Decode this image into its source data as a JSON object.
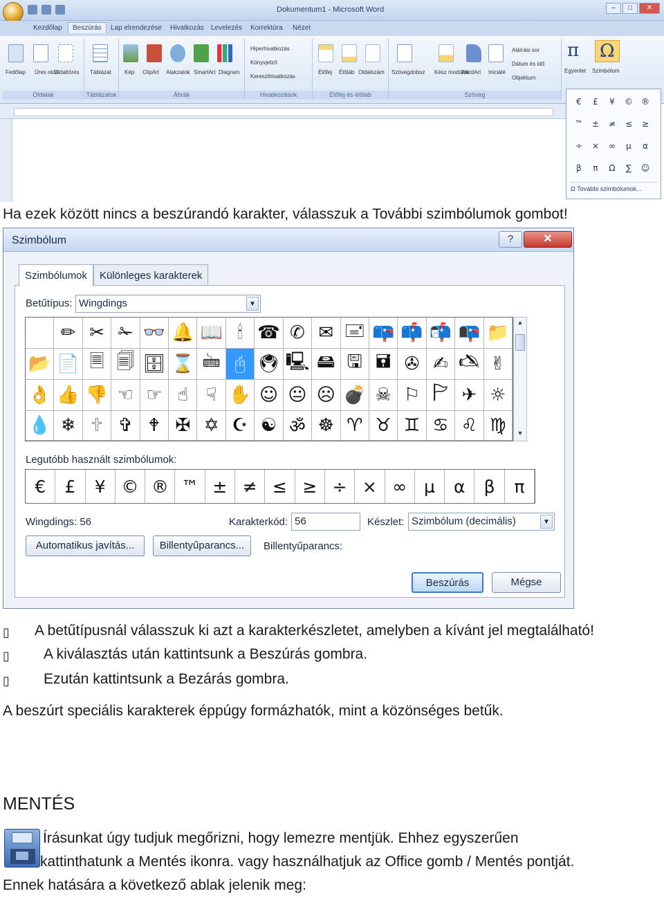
{
  "word_window": {
    "title": "Dokumentum1 - Microsoft Word",
    "ribbon_tabs": [
      "Kezdőlap",
      "Beszúrás",
      "Lap elrendezése",
      "Hivatkozás",
      "Levelezés",
      "Korrektúra",
      "Nézet"
    ],
    "active_tab": "Beszúrás",
    "groups": [
      {
        "label": "Oldalak",
        "buttons": [
          "Fedőlap",
          "Üres oldal",
          "Oldaltörés"
        ]
      },
      {
        "label": "Táblázatok",
        "buttons": [
          "Táblázat"
        ]
      },
      {
        "label": "Ábrák",
        "buttons": [
          "Kép",
          "ClipArt",
          "Alakzatok",
          "SmartArt",
          "Diagram"
        ]
      },
      {
        "label": "Hivatkozások",
        "buttons": [
          "Hiperhivatkozás",
          "Könyvjelző",
          "Kereszthivatkozás"
        ]
      },
      {
        "label": "Élőfej és élőláb",
        "buttons": [
          "Élőfej",
          "Élőláb",
          "Oldalszám"
        ]
      },
      {
        "label": "Szöveg",
        "buttons": [
          "Szövegdoboz",
          "Kész modulok",
          "WordArt",
          "Iniciálé",
          "Aláírási sor",
          "Dátum és idő",
          "Objektum"
        ]
      }
    ],
    "equation_label": "Egyenlet",
    "symbol_label": "Szimbólum",
    "symbol_dropdown": [
      "€",
      "£",
      "¥",
      "©",
      "®",
      "™",
      "±",
      "≠",
      "≤",
      "≥",
      "÷",
      "×",
      "∞",
      "µ",
      "α",
      "β",
      "π",
      "Ω",
      "∑",
      "☺"
    ],
    "more_symbols": "További szimbólumok..."
  },
  "text": {
    "line1": "Ha ezek között nincs a beszúrandó karakter, válasszuk a További szimbólumok gombot!",
    "bullet1": "A betűtípusnál válasszuk ki azt a karakterkészletet, amelyben a kívánt jel megtalálható!",
    "bullet2": "A kiválasztás után kattintsunk a Beszúrás gombra.",
    "bullet3": "Ezután kattintsunk a Bezárás gombra.",
    "para1": "A beszúrt speciális karakterek éppúgy formázhatók, mint a közönséges betűk.",
    "heading": "MENTÉS",
    "save_line1": "Írásunkat úgy tudjuk megőrizni, hogy lemezre mentjük. Ehhez egyszerűen",
    "save_line2": "kattinthatunk a Mentés ikonra.  vagy használhatjuk az Office gomb / Mentés pontját.",
    "save_line3": "Ennek hatására a következő ablak jelenik meg:",
    "bullet_glyph": "▯"
  },
  "dialog": {
    "title": "Szimbólum",
    "help": "?",
    "close": "✕",
    "tabs": [
      "Szimbólumok",
      "Különleges karakterek"
    ],
    "font_label": "Betűtípus:",
    "font_value": "Wingdings",
    "grid": [
      [
        "",
        "✏",
        "✂",
        "✁",
        "👓",
        "🔔",
        "📖",
        "🕯",
        "☎",
        "✆",
        "✉",
        "🖃",
        "📪",
        "📫",
        "📬",
        "📭",
        "📁"
      ],
      [
        "📂",
        "📄",
        "🗏",
        "🗐",
        "🗄",
        "⌛",
        "🖮",
        "🖰",
        "🖲",
        "🖳",
        "🖴",
        "🖫",
        "🖬",
        "✇",
        "✍",
        "🖎",
        "✌"
      ],
      [
        "👌",
        "👍",
        "👎",
        "☜",
        "☞",
        "☝",
        "☟",
        "✋",
        "☺",
        "😐",
        "☹",
        "💣",
        "☠",
        "⚐",
        "🏱",
        "✈",
        "☼"
      ],
      [
        "💧",
        "❄",
        "🕆",
        "✞",
        "🕈",
        "✠",
        "✡",
        "☪",
        "☯",
        "ॐ",
        "☸",
        "♈",
        "♉",
        "♊",
        "♋",
        "♌",
        "♍"
      ]
    ],
    "selected_index": [
      1,
      7
    ],
    "recent_label": "Legutóbb használt szimbólumok:",
    "recent": [
      "€",
      "£",
      "¥",
      "©",
      "®",
      "™",
      "±",
      "≠",
      "≤",
      "≥",
      "÷",
      "×",
      "∞",
      "µ",
      "α",
      "β",
      "π"
    ],
    "char_name": "Wingdings: 56",
    "code_label": "Karakterkód:",
    "code_value": "56",
    "set_label": "Készlet:",
    "set_value": "Szimbólum (decimális)",
    "autocorrect_btn": "Automatikus javítás...",
    "shortcut_btn": "Billentyűparancs...",
    "shortcut_label": "Billentyűparancs:",
    "insert_btn": "Beszúrás",
    "cancel_btn": "Mégse"
  }
}
